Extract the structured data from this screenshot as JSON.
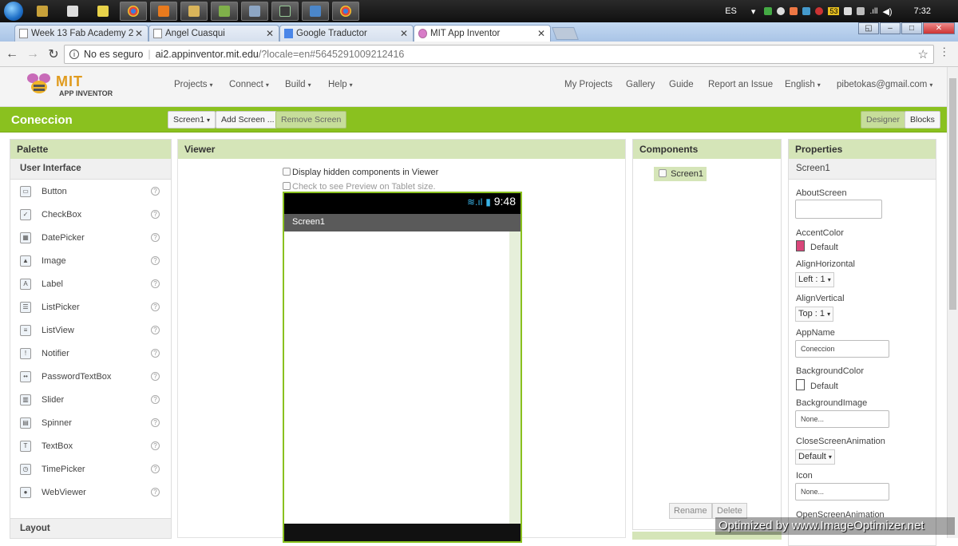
{
  "taskbar": {
    "apps": [
      "start-orb",
      "tools",
      "calculator",
      "notebook",
      "chrome",
      "media-player",
      "file-manager",
      "messenger",
      "browser",
      "terminal",
      "display",
      "chrome-alt"
    ],
    "language": "ES",
    "clock": "7:32",
    "tray_badge": "53"
  },
  "tabs": [
    {
      "label": "Week 13 Fab Academy 2"
    },
    {
      "label": "Angel Cuasqui"
    },
    {
      "label": "Google Traductor"
    },
    {
      "label": "MIT App Inventor"
    }
  ],
  "address": {
    "security": "No es seguro",
    "host": "ai2.appinventor.mit.edu",
    "path": "/?locale=en#5645291009212416"
  },
  "header": {
    "logo_mit": "MIT",
    "logo_sub": "APP INVENTOR",
    "menus": [
      "Projects",
      "Connect",
      "Build",
      "Help"
    ],
    "links": [
      "My Projects",
      "Gallery",
      "Guide",
      "Report an Issue"
    ],
    "language": "English",
    "account": "pibetokas@gmail.com"
  },
  "projectbar": {
    "name": "Coneccion",
    "screen_select": "Screen1",
    "add_screen": "Add Screen ...",
    "remove_screen": "Remove Screen",
    "designer": "Designer",
    "blocks": "Blocks"
  },
  "palette": {
    "title": "Palette",
    "section": "User Interface",
    "items": [
      {
        "label": "Button",
        "icon": "button-icon"
      },
      {
        "label": "CheckBox",
        "icon": "checkbox-icon"
      },
      {
        "label": "DatePicker",
        "icon": "datepicker-icon"
      },
      {
        "label": "Image",
        "icon": "image-icon"
      },
      {
        "label": "Label",
        "icon": "label-icon"
      },
      {
        "label": "ListPicker",
        "icon": "listpicker-icon"
      },
      {
        "label": "ListView",
        "icon": "listview-icon"
      },
      {
        "label": "Notifier",
        "icon": "notifier-icon"
      },
      {
        "label": "PasswordTextBox",
        "icon": "password-icon"
      },
      {
        "label": "Slider",
        "icon": "slider-icon"
      },
      {
        "label": "Spinner",
        "icon": "spinner-icon"
      },
      {
        "label": "TextBox",
        "icon": "textbox-icon"
      },
      {
        "label": "TimePicker",
        "icon": "timepicker-icon"
      },
      {
        "label": "WebViewer",
        "icon": "webviewer-icon"
      }
    ],
    "next_section": "Layout"
  },
  "viewer": {
    "title": "Viewer",
    "hidden_components": "Display hidden components in Viewer",
    "tablet_preview": "Check to see Preview on Tablet size.",
    "phone_time": "9:48",
    "screen_title": "Screen1"
  },
  "components": {
    "title": "Components",
    "tree_root": "Screen1",
    "rename": "Rename",
    "delete": "Delete"
  },
  "properties": {
    "title": "Properties",
    "component": "Screen1",
    "about_label": "AboutScreen",
    "accent_label": "AccentColor",
    "accent_value": "Default",
    "accent_color": "#d9467a",
    "alignh_label": "AlignHorizontal",
    "alignh_value": "Left : 1",
    "alignv_label": "AlignVertical",
    "alignv_value": "Top : 1",
    "appname_label": "AppName",
    "appname_value": "Coneccion",
    "bgcolor_label": "BackgroundColor",
    "bgcolor_value": "Default",
    "bgimage_label": "BackgroundImage",
    "bgimage_value": "None...",
    "closeanim_label": "CloseScreenAnimation",
    "closeanim_value": "Default",
    "icon_label": "Icon",
    "icon_value": "None...",
    "openanim_label": "OpenScreenAnimation"
  },
  "watermark": "Optimized by www.ImageOptimizer.net"
}
